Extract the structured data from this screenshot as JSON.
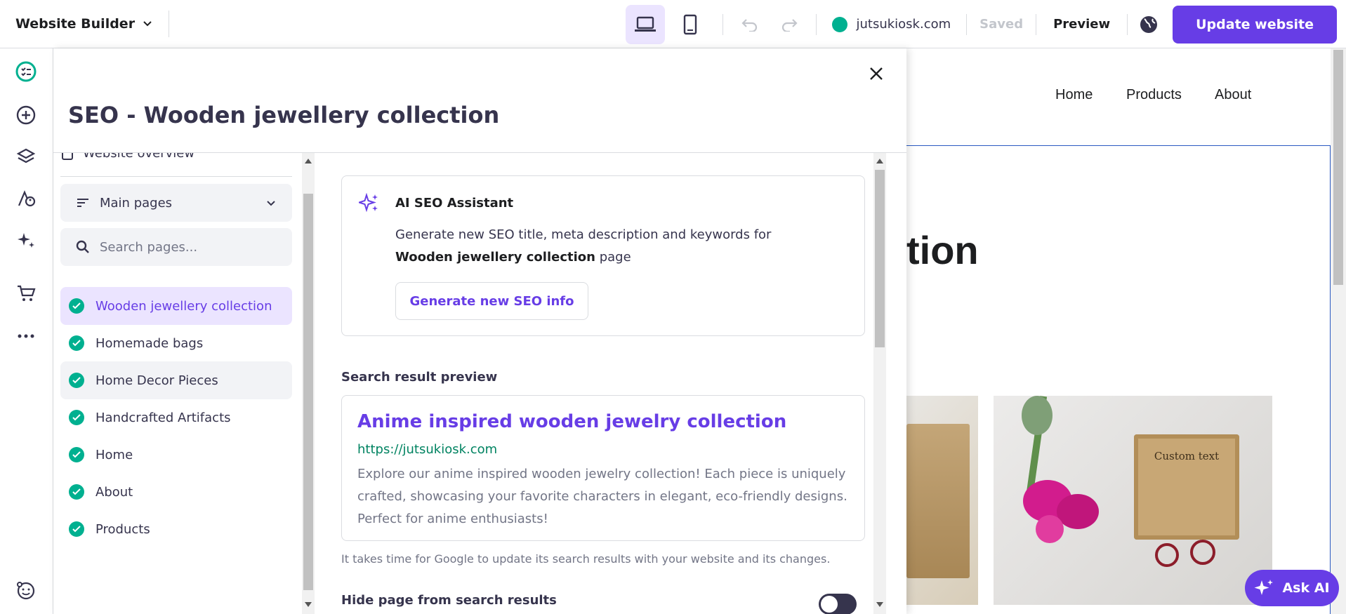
{
  "topbar": {
    "brand": "Website Builder",
    "domain": "jutsukiosk.com",
    "saved": "Saved",
    "preview": "Preview",
    "update": "Update website"
  },
  "leftbar": {
    "icons": [
      "checklist-icon",
      "add-icon",
      "layers-icon",
      "palette-icon",
      "ai-sparkle-icon",
      "cart-icon",
      "more-icon",
      "support-icon"
    ]
  },
  "panel": {
    "title": "SEO - Wooden jewellery collection",
    "cut_item": "Website overview",
    "filter": "Main pages",
    "search_placeholder": "Search pages...",
    "pages": [
      "Wooden jewellery collection",
      "Homemade bags",
      "Home Decor Pieces",
      "Handcrafted Artifacts",
      "Home",
      "About",
      "Products"
    ]
  },
  "ai": {
    "title": "AI SEO Assistant",
    "desc_pre": "Generate new SEO title, meta description and keywords for ",
    "desc_bold": "Wooden jewellery collection",
    "desc_post": " page",
    "button": "Generate new SEO info"
  },
  "search_preview": {
    "label": "Search result preview",
    "title": "Anime inspired wooden jewelry collection",
    "url": "https://jutsukiosk.com",
    "description": "Explore our anime inspired wooden jewelry collection! Each piece is uniquely crafted, showcasing your favorite characters in elegant, eco-friendly designs. Perfect for anime enthusiasts!",
    "hint": "It takes time for Google to update its search results with your website and its changes."
  },
  "hide_page": {
    "label": "Hide page from search results",
    "enabled": false
  },
  "site": {
    "nav": [
      "Home",
      "Products",
      "About"
    ],
    "hero_fragment": "tion",
    "box_text": "Custom text"
  },
  "askai": "Ask AI",
  "colors": {
    "accent": "#673de6",
    "success": "#00b090",
    "active_bg": "#ebe4ff"
  }
}
